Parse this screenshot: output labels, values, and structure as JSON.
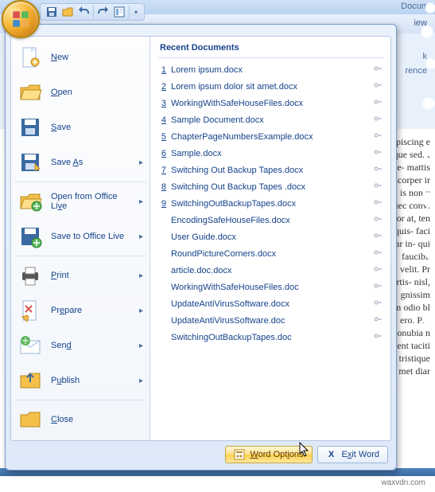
{
  "titlebar": {
    "truncated": "Docum"
  },
  "ribbon": {
    "tab_partial": "iew",
    "group_labels": [
      "k",
      "rence"
    ]
  },
  "qat": {
    "items": [
      "save",
      "open",
      "undo",
      "redo",
      "style",
      "customize"
    ]
  },
  "left_menu": [
    {
      "key": "new",
      "html": "<u>N</u>ew",
      "arrow": false,
      "icon": "page"
    },
    {
      "key": "open",
      "html": "<u>O</u>pen",
      "arrow": false,
      "icon": "folder"
    },
    {
      "key": "save",
      "html": "<u>S</u>ave",
      "arrow": false,
      "icon": "disk"
    },
    {
      "key": "saveas",
      "html": "Save <u>A</u>s",
      "arrow": true,
      "icon": "disk2"
    },
    {
      "key": "openlive",
      "html": "Open from Office Li<u>v</u>e",
      "arrow": true,
      "icon": "folder2"
    },
    {
      "key": "savelive",
      "html": "Save to Office Live",
      "arrow": true,
      "icon": "disk3"
    },
    {
      "key": "print",
      "html": "<u>P</u>rint",
      "arrow": true,
      "icon": "print"
    },
    {
      "key": "prepare",
      "html": "Pr<u>e</u>pare",
      "arrow": true,
      "icon": "prepare"
    },
    {
      "key": "send",
      "html": "Sen<u>d</u>",
      "arrow": true,
      "icon": "send"
    },
    {
      "key": "publish",
      "html": "P<u>u</u>blish",
      "arrow": true,
      "icon": "publish"
    },
    {
      "key": "close",
      "html": "<u>C</u>lose",
      "arrow": false,
      "icon": "folder3"
    }
  ],
  "separators_after": [
    "saveas",
    "savelive",
    "publish"
  ],
  "recent": {
    "header": "Recent Documents",
    "items": [
      {
        "n": "1",
        "name": "Lorem ipsum.docx"
      },
      {
        "n": "2",
        "name": "Lorem ipsum dolor sit amet.docx"
      },
      {
        "n": "3",
        "name": "WorkingWithSafeHouseFiles.docx"
      },
      {
        "n": "4",
        "name": "Sample Document.docx"
      },
      {
        "n": "5",
        "name": "ChapterPageNumbersExample.docx"
      },
      {
        "n": "6",
        "name": "Sample.docx"
      },
      {
        "n": "7",
        "name": "Switching Out Backup Tapes.docx"
      },
      {
        "n": "8",
        "name": "Switching Out Backup Tapes .docx"
      },
      {
        "n": "9",
        "name": "SwitchingOutBackupTapes.docx"
      },
      {
        "n": "",
        "name": "EncodingSafeHouseFiles.docx"
      },
      {
        "n": "",
        "name": "User Guide.docx"
      },
      {
        "n": "",
        "name": "RoundPictureCorners.docx"
      },
      {
        "n": "",
        "name": "article.doc.docx"
      },
      {
        "n": "",
        "name": "WorkingWithSafeHouseFiles.doc"
      },
      {
        "n": "",
        "name": "UpdateAntiVirusSoftware.docx"
      },
      {
        "n": "",
        "name": "UpdateAntiVirusSoftware.doc"
      },
      {
        "n": "",
        "name": "SwitchingOutBackupTapes.doc"
      }
    ]
  },
  "footer": {
    "options": "Word Options",
    "exit": "Exit Word"
  },
  "doc_fragments": [
    "piscing e",
    "que sed. I",
    "he- mattis",
    "hcorper ir",
    "is non u",
    "iec conv:",
    "or at, ten",
    "quis- faci",
    "ar in- qui",
    "faucibu",
    "",
    "velit. Pr",
    "rtis- nisl,",
    "gnissim",
    "m odio bl",
    "ero. Pro",
    "onubia n",
    "ent taciti",
    "tristique",
    "met diar"
  ],
  "watermark": "waxvdn.com"
}
